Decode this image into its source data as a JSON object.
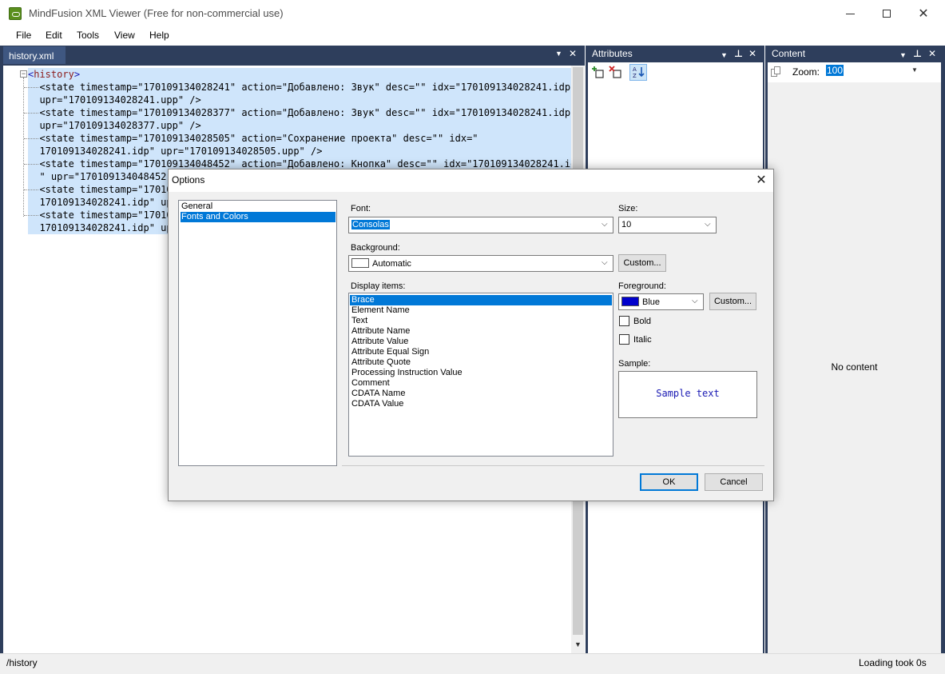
{
  "window": {
    "title": "MindFusion XML Viewer (Free for non-commercial use)",
    "icon": "app-logo-icon",
    "controls": [
      "minimize-icon",
      "maximize-icon",
      "close-icon"
    ]
  },
  "menu": {
    "items": [
      "File",
      "Edit",
      "Tools",
      "View",
      "Help"
    ]
  },
  "editor": {
    "tab_label": "history.xml",
    "root_tag": "history",
    "lines": [
      "<state timestamp=\"170109134028241\" action=\"Добавлено: Звук\" desc=\"\" idx=\"170109134028241.idp\"",
      "upr=\"170109134028241.upp\" />",
      "<state timestamp=\"170109134028377\" action=\"Добавлено: Звук\" desc=\"\" idx=\"170109134028241.idp\"",
      "upr=\"170109134028377.upp\" />",
      "<state timestamp=\"170109134028505\" action=\"Сохранение проекта\" desc=\"\" idx=\"",
      "170109134028241.idp\" upr=\"170109134028505.upp\" />",
      "<state timestamp=\"170109134048452\" action=\"Добавлено: Кнопка\" desc=\"\" idx=\"170109134028241.idp",
      "\" upr=\"170109134048452.",
      "<state timestamp=\"17010",
      "170109134028241.idp\" up",
      "<state timestamp=\"17010",
      "170109134028241.idp\" up"
    ]
  },
  "attributes": {
    "title": "Attributes"
  },
  "content": {
    "title": "Content",
    "zoom_label": "Zoom:",
    "zoom_value": "100",
    "empty_text": "No content"
  },
  "statusbar": {
    "path": "/history",
    "load_time": "Loading took 0s"
  },
  "dialog": {
    "title": "Options",
    "categories": [
      "General",
      "Fonts and Colors"
    ],
    "selected_category": "Fonts and Colors",
    "font_label": "Font:",
    "font_value": "Consolas",
    "size_label": "Size:",
    "size_value": "10",
    "background_label": "Background:",
    "background_value": "Automatic",
    "background_color": "#ffffff",
    "custom_label": "Custom...",
    "display_items_label": "Display items:",
    "display_items": [
      "Brace",
      "Element Name",
      "Text",
      "Attribute Name",
      "Attribute Value",
      "Attribute Equal Sign",
      "Attribute Quote",
      "Processing Instruction Value",
      "Comment",
      "CDATA Name",
      "CDATA Value"
    ],
    "selected_display_item": "Brace",
    "foreground_label": "Foreground:",
    "foreground_value": "Blue",
    "foreground_color": "#0000cc",
    "bold_label": "Bold",
    "italic_label": "Italic",
    "sample_label": "Sample:",
    "sample_text": "Sample text",
    "ok_label": "OK",
    "cancel_label": "Cancel"
  },
  "colors": {
    "panel_dark": "#2e3e5c",
    "tab_active": "#3f5781",
    "selection": "#0078d7",
    "line_highlight": "#cfe5fb"
  }
}
